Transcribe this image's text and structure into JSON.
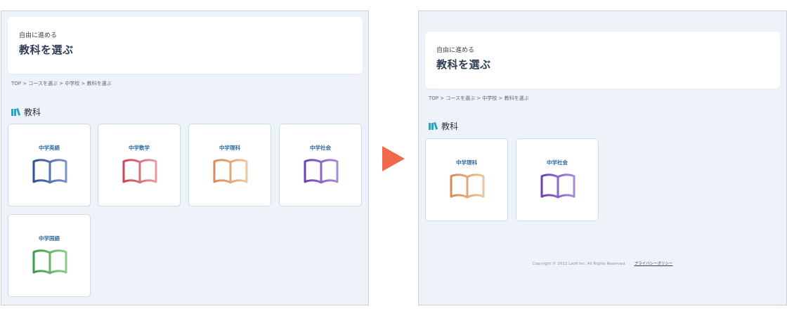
{
  "before": {
    "header": {
      "subtitle": "自由に進める",
      "title": "教科を選ぶ"
    },
    "breadcrumb": "TOP > コースを選ぶ > 中学校 > 教科を選ぶ",
    "section_title": "教科",
    "subjects": [
      {
        "label": "中学英語",
        "color_light": "#7c93c9",
        "color_dark": "#2f4f96"
      },
      {
        "label": "中学数学",
        "color_light": "#e79aa3",
        "color_dark": "#c94456"
      },
      {
        "label": "中学理科",
        "color_light": "#efc49a",
        "color_dark": "#d98a5b"
      },
      {
        "label": "中学社会",
        "color_light": "#a98ad8",
        "color_dark": "#6a43b5"
      },
      {
        "label": "中学国語",
        "color_light": "#8dcb8a",
        "color_dark": "#3f9a4a"
      }
    ]
  },
  "after": {
    "header": {
      "subtitle": "自由に進める",
      "title": "教科を選ぶ"
    },
    "breadcrumb": "TOP > コースを選ぶ > 中学校 > 教科を選ぶ",
    "section_title": "教科",
    "subjects": [
      {
        "label": "中学理科",
        "color_light": "#efc49a",
        "color_dark": "#d98a5b"
      },
      {
        "label": "中学社会",
        "color_light": "#a98ad8",
        "color_dark": "#6a43b5"
      }
    ],
    "footer": {
      "copyright": "Copyright © 2022 Lsoft Inc. All Rights Reserved.",
      "privacy_link": "プライバシーポリシー"
    }
  },
  "colors": {
    "arrow": "#f2684a",
    "section_icon": "#2aa3c9",
    "subject_label": "#2b6aa3",
    "page_bg": "#eef3f9"
  },
  "icons": {
    "section": "books-icon",
    "subject": "open-book-icon",
    "transition": "right-arrow-icon"
  }
}
